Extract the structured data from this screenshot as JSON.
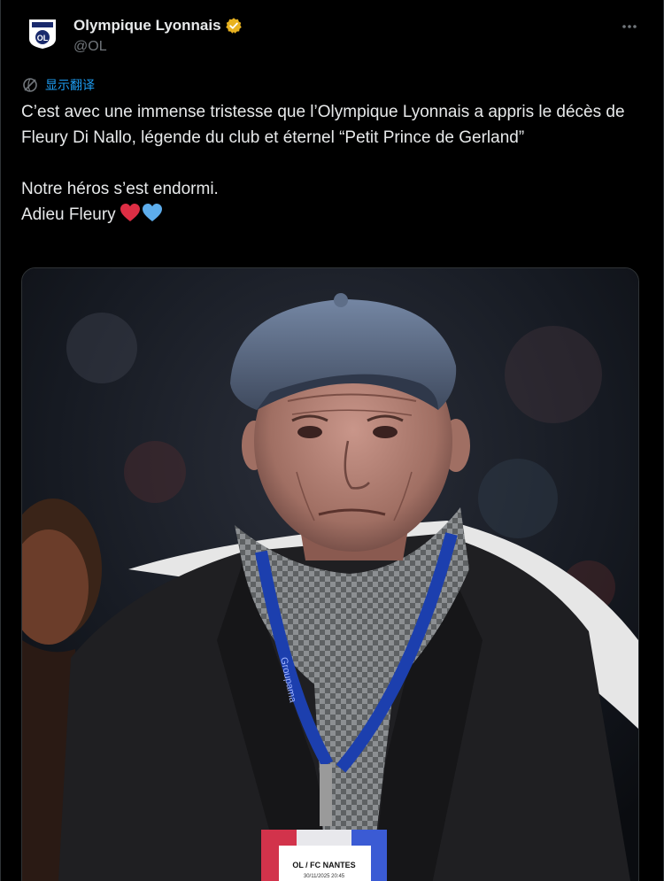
{
  "author": {
    "display_name": "Olympique Lyonnais",
    "handle": "@OL",
    "verified": true,
    "verified_color": "#e8b220",
    "avatar_logo_text": "OL"
  },
  "header": {
    "more_icon": "more-horizontal-icon"
  },
  "translate": {
    "label": "显示翻译",
    "icon": "translate-globe-icon"
  },
  "tweet": {
    "line1": "C’est avec une immense tristesse que l’Olympique Lyonnais a appris le décès de Fleury Di Nallo, légende du club et éternel “Petit Prince de Gerland”",
    "line2": "Notre héros s’est endormi.",
    "line3": "Adieu Fleury",
    "emoji": [
      "red-heart",
      "blue-heart"
    ]
  },
  "media": {
    "alt": "photo",
    "badge_text": "OL / FC NANTES",
    "badge_subtext": "30/11/2025 20:45",
    "lanyard_text": "Groupama"
  },
  "colors": {
    "accent": "#1d9bf0",
    "text": "#e7e9ea",
    "muted": "#71767b",
    "background": "#000000",
    "border": "#2f3336"
  }
}
